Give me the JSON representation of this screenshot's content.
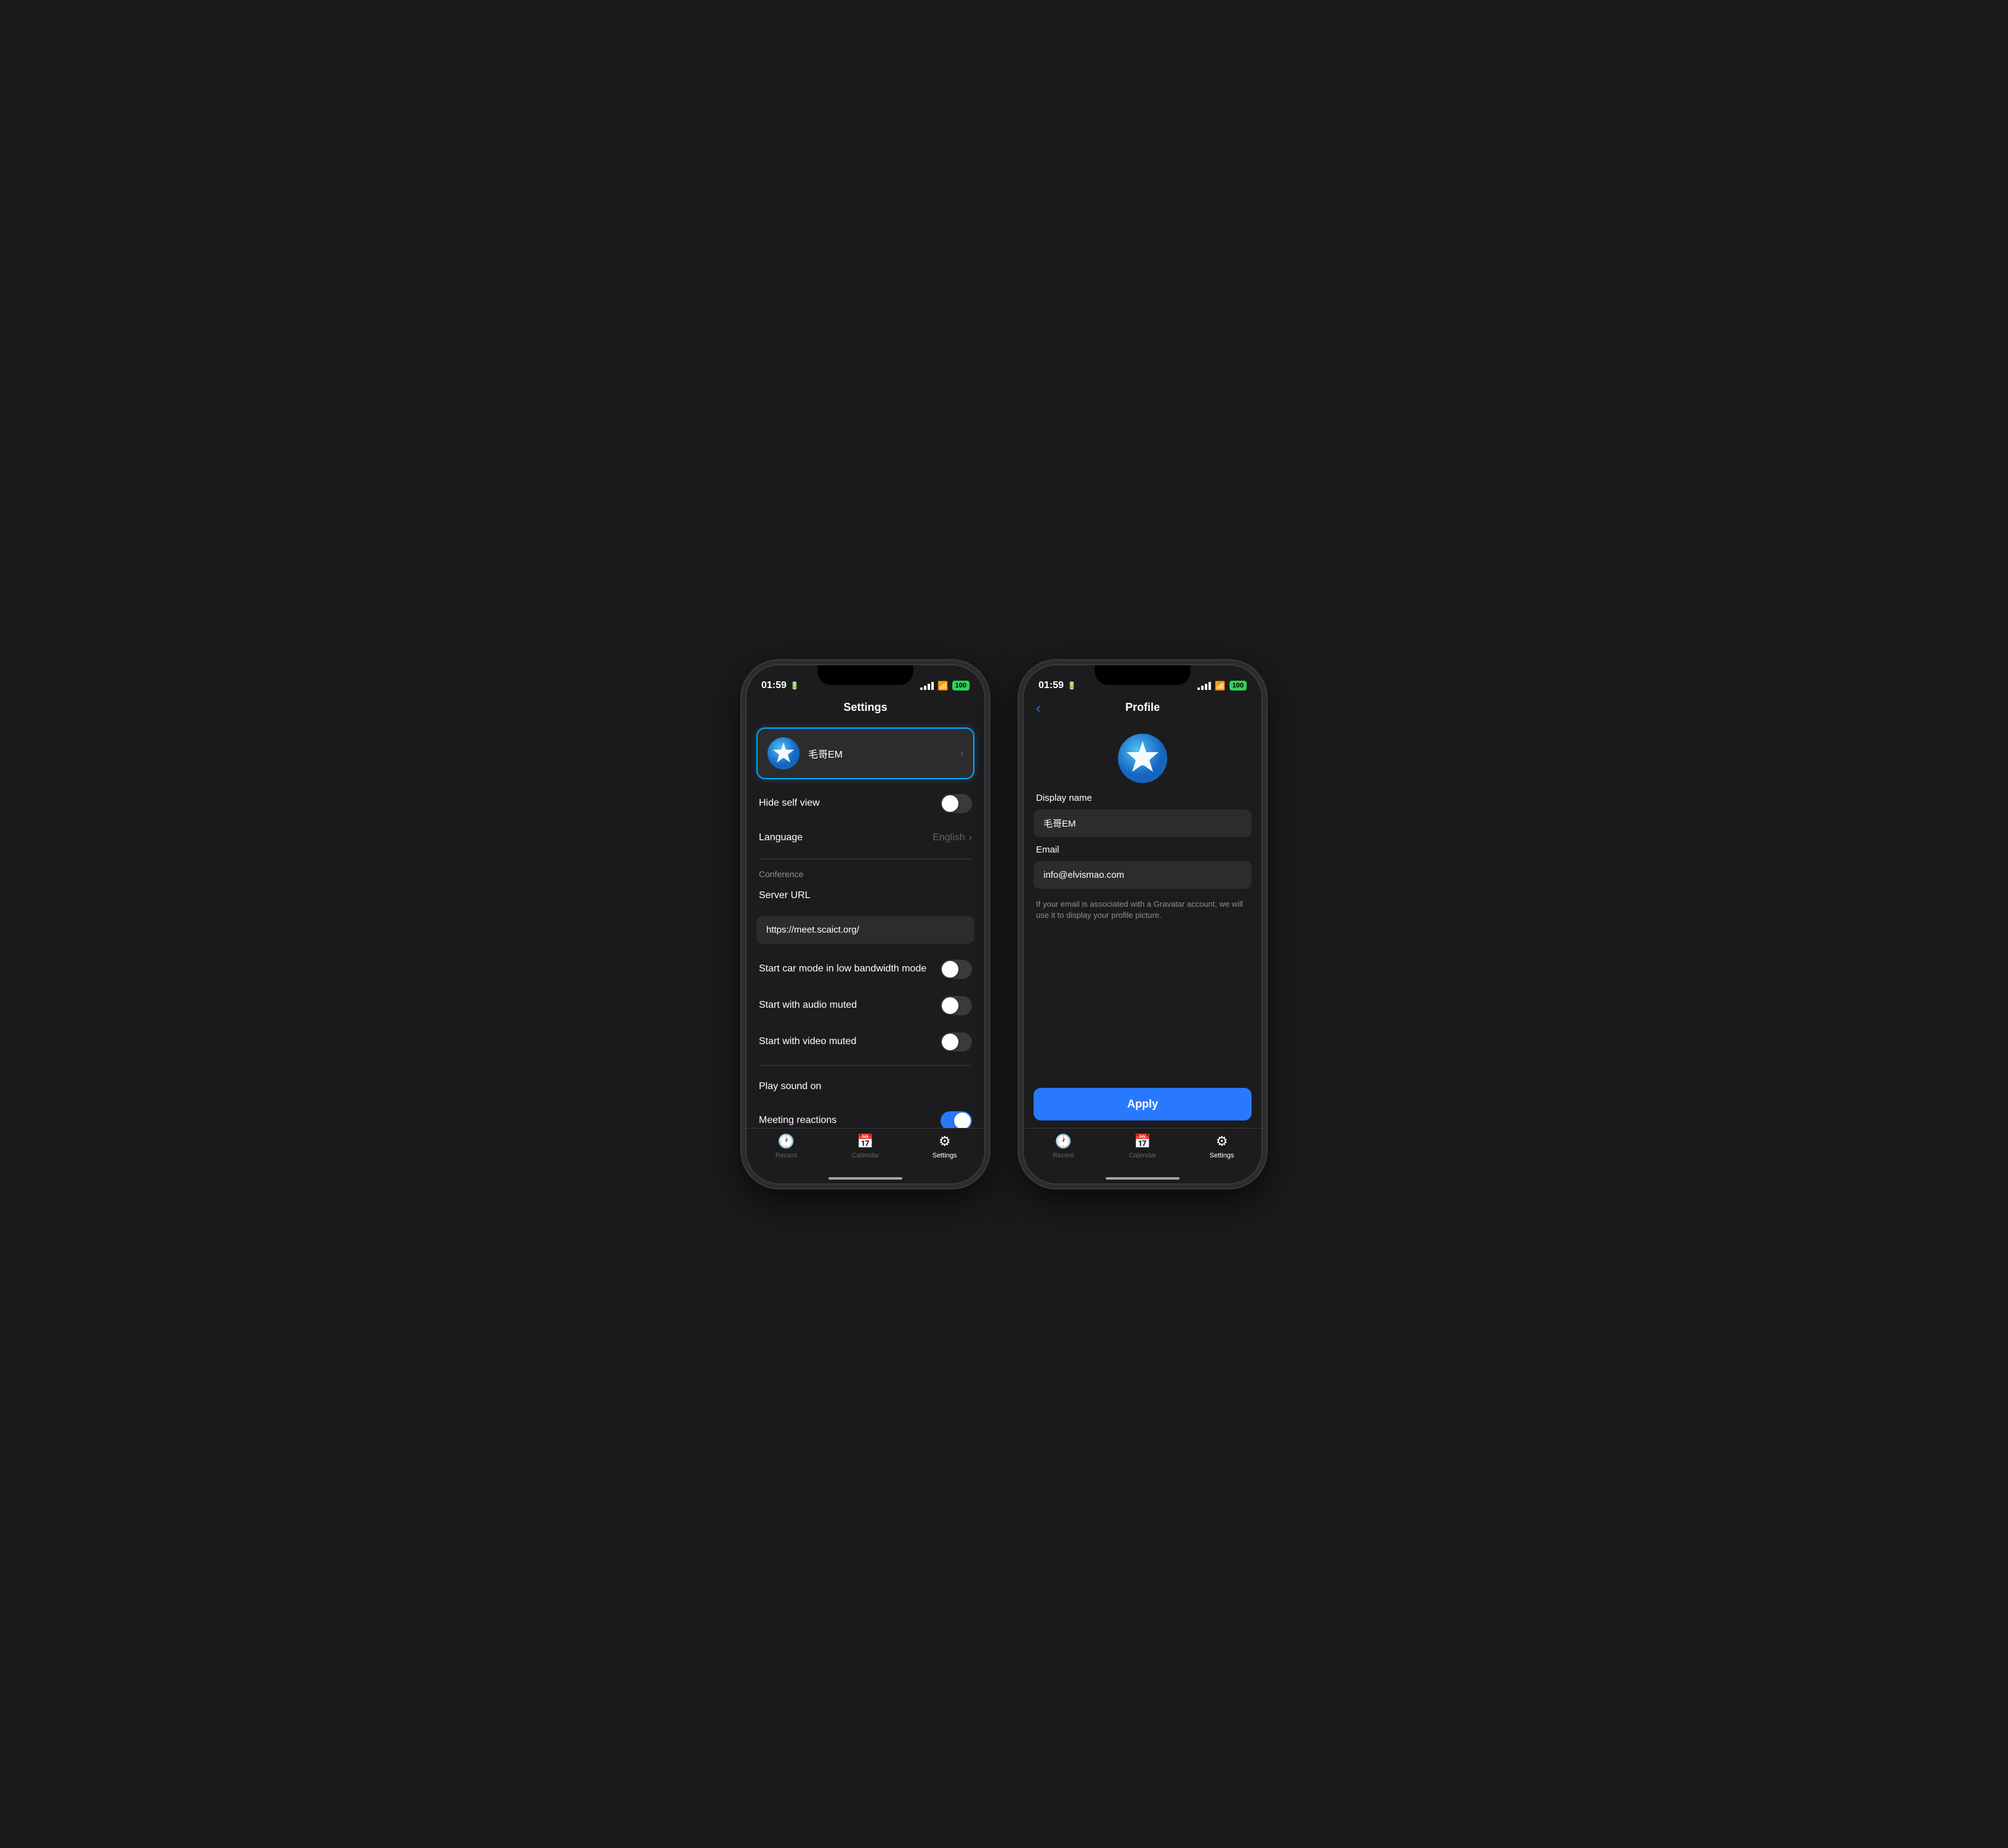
{
  "phone1": {
    "statusBar": {
      "time": "01:59",
      "battery": "100"
    },
    "header": {
      "title": "Settings"
    },
    "profile": {
      "name": "毛哥EM",
      "chevron": "›"
    },
    "settings": {
      "hideSelfView": {
        "label": "Hide self view",
        "value": false
      },
      "language": {
        "label": "Language",
        "value": "English"
      },
      "conference": {
        "sectionLabel": "Conference",
        "serverUrl": {
          "label": "Server URL",
          "value": "https://meet.scaict.org/"
        },
        "carMode": {
          "label": "Start car mode in low bandwidth mode",
          "value": false
        },
        "audioMuted": {
          "label": "Start with audio muted",
          "value": false
        },
        "videoMuted": {
          "label": "Start with video muted",
          "value": false
        }
      },
      "playSoundLabel": "Play sound on",
      "meetingReactions": {
        "label": "Meeting reactions",
        "value": true
      }
    },
    "tabBar": {
      "items": [
        {
          "icon": "🕐",
          "label": "Recent",
          "active": false
        },
        {
          "icon": "📅",
          "label": "Calendar",
          "active": false
        },
        {
          "icon": "⚙",
          "label": "Settings",
          "active": true
        }
      ]
    }
  },
  "phone2": {
    "statusBar": {
      "time": "01:59",
      "battery": "100"
    },
    "header": {
      "title": "Profile",
      "backLabel": "‹"
    },
    "profile": {
      "displayNameLabel": "Display name",
      "displayNameValue": "毛哥EM",
      "emailLabel": "Email",
      "emailValue": "info@elvismao.com",
      "helperText": "If your email is associated with a Gravatar account, we will use it to display your profile picture."
    },
    "applyButton": "Apply",
    "tabBar": {
      "items": [
        {
          "icon": "🕐",
          "label": "Recent",
          "active": false
        },
        {
          "icon": "📅",
          "label": "Calendar",
          "active": false
        },
        {
          "icon": "⚙",
          "label": "Settings",
          "active": true
        }
      ]
    }
  }
}
